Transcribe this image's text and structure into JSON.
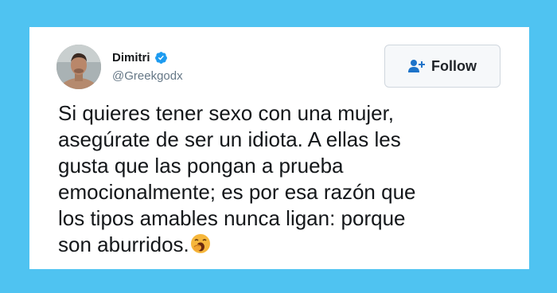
{
  "tweet": {
    "author_name": "Dimitri",
    "author_handle": "@Greekgodx",
    "follow_label": "Follow",
    "text": "Si quieres tener sexo con una mujer,\nasegúrate de ser un idiota. A ellas les\ngusta que las pongan a prueba\nemocionalmente; es por esa razón que\nlos tipos amables nunca ligan: porque\nson aburridos.",
    "emoji": "yawning-face",
    "verified_color": "#1d9bf0",
    "follow_icon": "person-add-icon",
    "follow_icon_color": "#1d73c9"
  },
  "colors": {
    "background": "#4fc3f1",
    "card": "#ffffff",
    "text": "#14171a",
    "handle": "#657786"
  }
}
